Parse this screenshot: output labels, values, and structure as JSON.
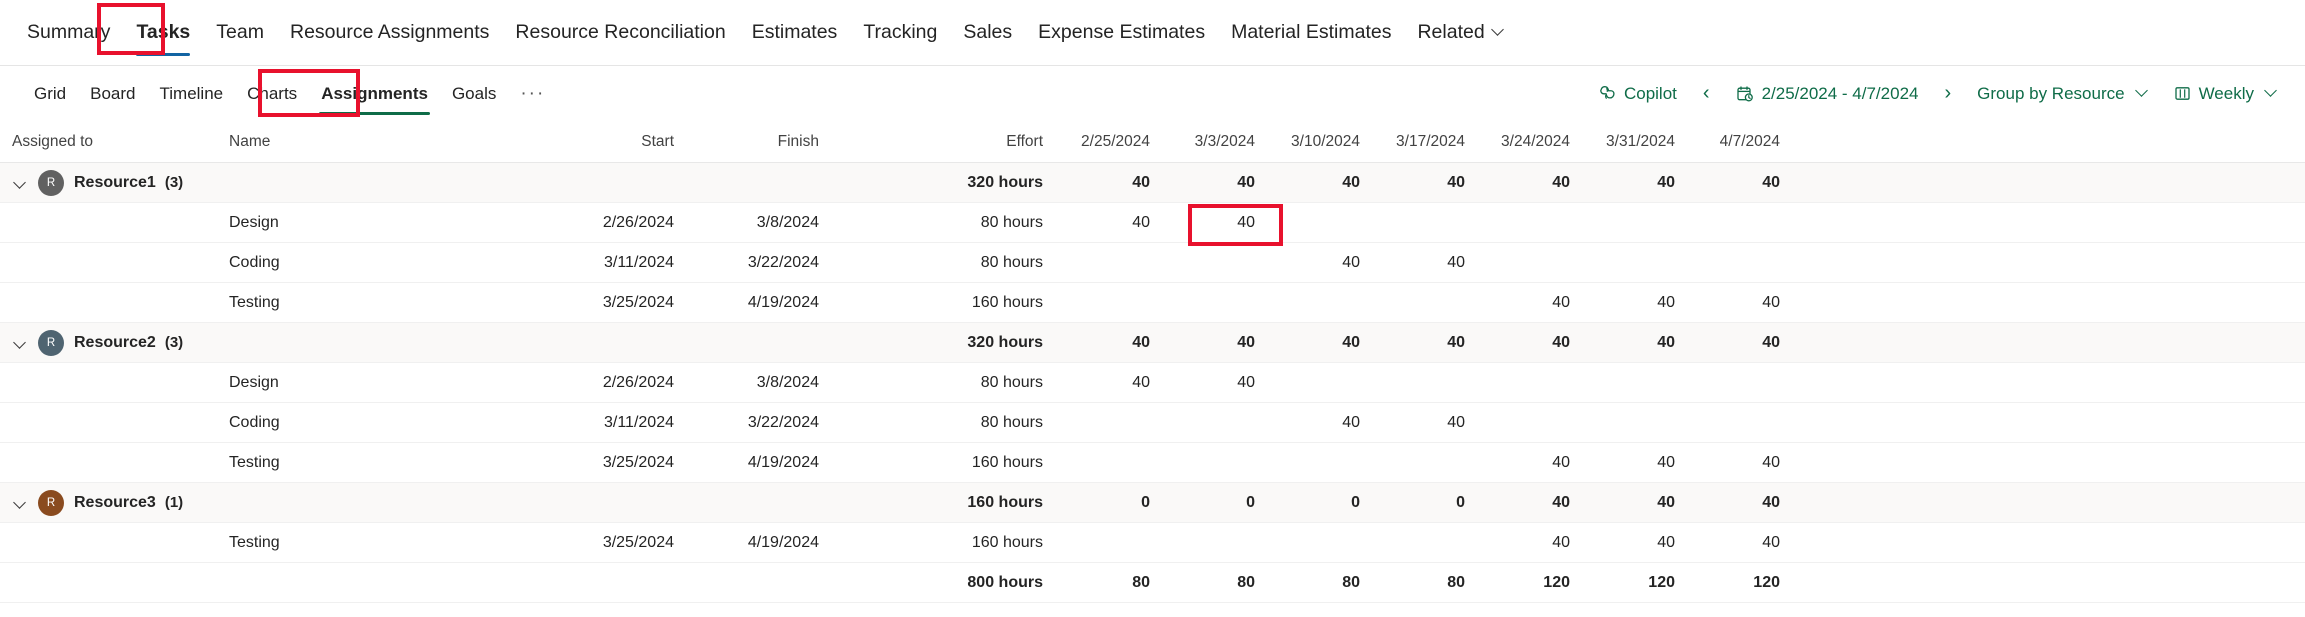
{
  "topnav": {
    "items": [
      {
        "label": "Summary",
        "active": false,
        "caret": false
      },
      {
        "label": "Tasks",
        "active": true,
        "caret": false
      },
      {
        "label": "Team",
        "active": false,
        "caret": false
      },
      {
        "label": "Resource Assignments",
        "active": false,
        "caret": false
      },
      {
        "label": "Resource Reconciliation",
        "active": false,
        "caret": false
      },
      {
        "label": "Estimates",
        "active": false,
        "caret": false
      },
      {
        "label": "Tracking",
        "active": false,
        "caret": false
      },
      {
        "label": "Sales",
        "active": false,
        "caret": false
      },
      {
        "label": "Expense Estimates",
        "active": false,
        "caret": false
      },
      {
        "label": "Material Estimates",
        "active": false,
        "caret": false
      },
      {
        "label": "Related",
        "active": false,
        "caret": true
      }
    ]
  },
  "subtabs": {
    "items": [
      {
        "label": "Grid",
        "active": false
      },
      {
        "label": "Board",
        "active": false
      },
      {
        "label": "Timeline",
        "active": false
      },
      {
        "label": "Charts",
        "active": false
      },
      {
        "label": "Assignments",
        "active": true
      },
      {
        "label": "Goals",
        "active": false
      }
    ],
    "overflow_label": "···"
  },
  "toolbar": {
    "copilot_label": "Copilot",
    "prev_label": "‹",
    "next_label": "›",
    "date_range": "2/25/2024 - 4/7/2024",
    "group_by_label": "Group by Resource",
    "view_label": "Weekly"
  },
  "grid": {
    "columns": {
      "assigned_to": "Assigned to",
      "name": "Name",
      "start": "Start",
      "finish": "Finish",
      "effort": "Effort"
    },
    "week_columns": [
      "2/25/2024",
      "3/3/2024",
      "3/10/2024",
      "3/17/2024",
      "3/24/2024",
      "3/31/2024",
      "4/7/2024"
    ],
    "groups": [
      {
        "resource": "Resource1",
        "count": "(3)",
        "avatar_initial": "R",
        "avatar_color": "#616161",
        "effort": "320 hours",
        "weeks": [
          "40",
          "40",
          "40",
          "40",
          "40",
          "40",
          "40"
        ],
        "tasks": [
          {
            "name": "Design",
            "start": "2/26/2024",
            "finish": "3/8/2024",
            "effort": "80 hours",
            "weeks": [
              "40",
              "40",
              "",
              "",
              "",
              "",
              ""
            ]
          },
          {
            "name": "Coding",
            "start": "3/11/2024",
            "finish": "3/22/2024",
            "effort": "80 hours",
            "weeks": [
              "",
              "",
              "40",
              "40",
              "",
              "",
              ""
            ]
          },
          {
            "name": "Testing",
            "start": "3/25/2024",
            "finish": "4/19/2024",
            "effort": "160 hours",
            "weeks": [
              "",
              "",
              "",
              "",
              "40",
              "40",
              "40"
            ]
          }
        ]
      },
      {
        "resource": "Resource2",
        "count": "(3)",
        "avatar_initial": "R",
        "avatar_color": "#4f6471",
        "effort": "320 hours",
        "weeks": [
          "40",
          "40",
          "40",
          "40",
          "40",
          "40",
          "40"
        ],
        "tasks": [
          {
            "name": "Design",
            "start": "2/26/2024",
            "finish": "3/8/2024",
            "effort": "80 hours",
            "weeks": [
              "40",
              "40",
              "",
              "",
              "",
              "",
              ""
            ]
          },
          {
            "name": "Coding",
            "start": "3/11/2024",
            "finish": "3/22/2024",
            "effort": "80 hours",
            "weeks": [
              "",
              "",
              "40",
              "40",
              "",
              "",
              ""
            ]
          },
          {
            "name": "Testing",
            "start": "3/25/2024",
            "finish": "4/19/2024",
            "effort": "160 hours",
            "weeks": [
              "",
              "",
              "",
              "",
              "40",
              "40",
              "40"
            ]
          }
        ]
      },
      {
        "resource": "Resource3",
        "count": "(1)",
        "avatar_initial": "R",
        "avatar_color": "#8a4b1f",
        "effort": "160 hours",
        "weeks": [
          "0",
          "0",
          "0",
          "0",
          "40",
          "40",
          "40"
        ],
        "tasks": [
          {
            "name": "Testing",
            "start": "3/25/2024",
            "finish": "4/19/2024",
            "effort": "160 hours",
            "weeks": [
              "",
              "",
              "",
              "",
              "40",
              "40",
              "40"
            ]
          }
        ]
      }
    ],
    "total": {
      "effort": "800 hours",
      "weeks": [
        "80",
        "80",
        "80",
        "80",
        "120",
        "120",
        "120"
      ]
    }
  },
  "annotations": {
    "accent_color": "#e8112d",
    "boxes": [
      "tasks-tab",
      "assignments-tab",
      "design-week-3-3-cell"
    ]
  }
}
